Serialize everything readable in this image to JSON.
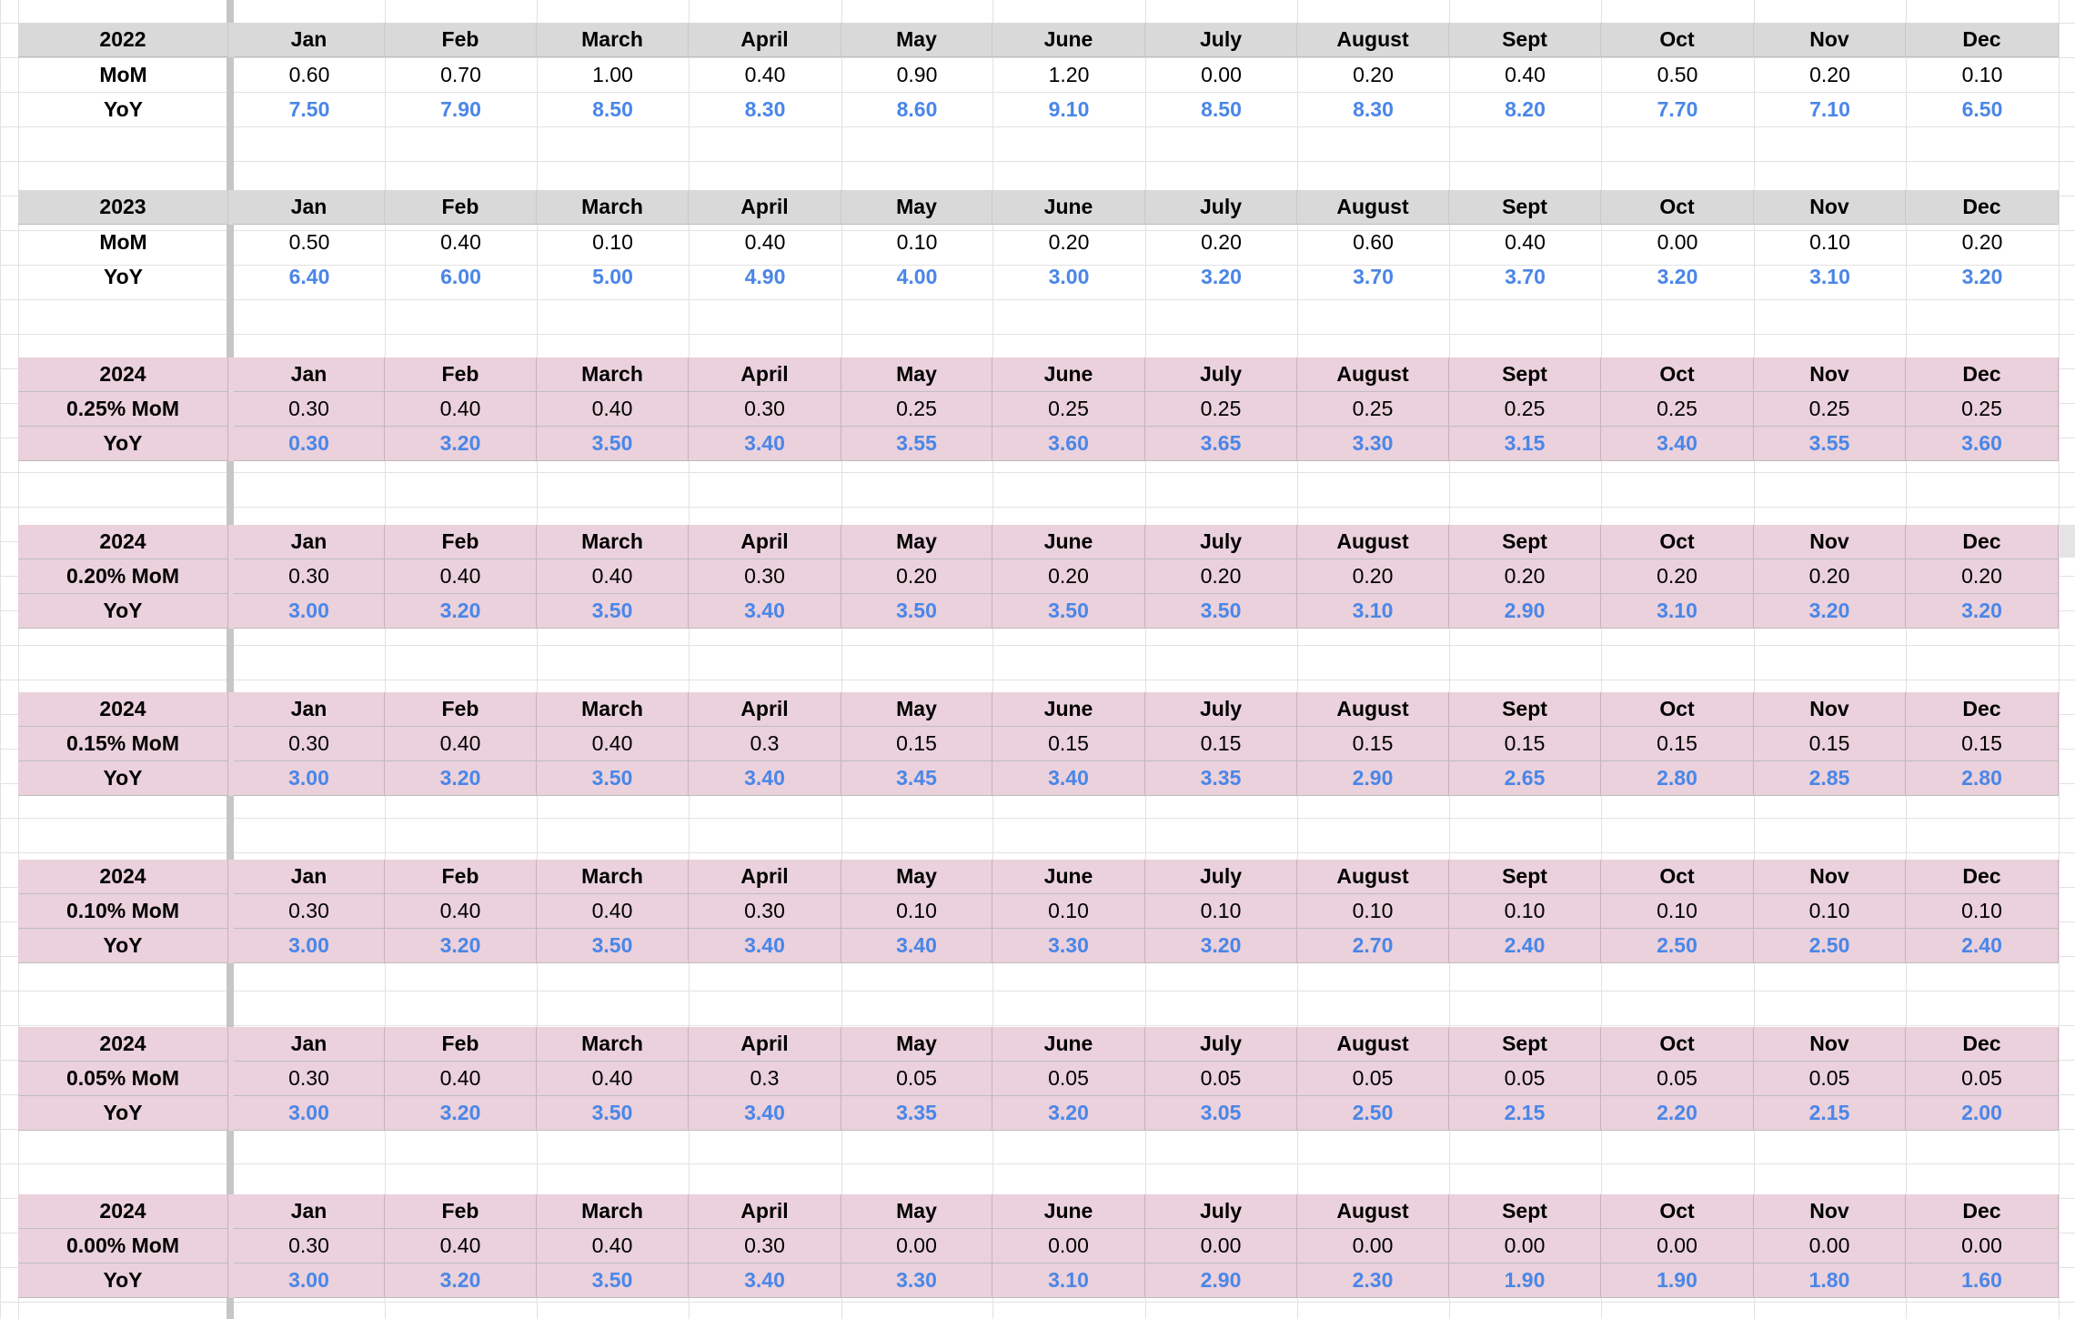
{
  "months": [
    "Jan",
    "Feb",
    "March",
    "April",
    "May",
    "June",
    "July",
    "August",
    "Sept",
    "Oct",
    "Nov",
    "Dec"
  ],
  "blocks": [
    {
      "style": "gray",
      "year": "2022",
      "mom_label": "MoM",
      "yoy_label": "YoY",
      "mom": [
        "0.60",
        "0.70",
        "1.00",
        "0.40",
        "0.90",
        "1.20",
        "0.00",
        "0.20",
        "0.40",
        "0.50",
        "0.20",
        "0.10"
      ],
      "yoy": [
        "7.50",
        "7.90",
        "8.50",
        "8.30",
        "8.60",
        "9.10",
        "8.50",
        "8.30",
        "8.20",
        "7.70",
        "7.10",
        "6.50"
      ]
    },
    {
      "style": "gray",
      "year": "2023",
      "mom_label": "MoM",
      "yoy_label": "YoY",
      "mom": [
        "0.50",
        "0.40",
        "0.10",
        "0.40",
        "0.10",
        "0.20",
        "0.20",
        "0.60",
        "0.40",
        "0.00",
        "0.10",
        "0.20"
      ],
      "yoy": [
        "6.40",
        "6.00",
        "5.00",
        "4.90",
        "4.00",
        "3.00",
        "3.20",
        "3.70",
        "3.70",
        "3.20",
        "3.10",
        "3.20"
      ]
    },
    {
      "style": "pink",
      "year": "2024",
      "mom_label": "0.25% MoM",
      "yoy_label": "YoY",
      "mom": [
        "0.30",
        "0.40",
        "0.40",
        "0.30",
        "0.25",
        "0.25",
        "0.25",
        "0.25",
        "0.25",
        "0.25",
        "0.25",
        "0.25"
      ],
      "yoy": [
        "0.30",
        "3.20",
        "3.50",
        "3.40",
        "3.55",
        "3.60",
        "3.65",
        "3.30",
        "3.15",
        "3.40",
        "3.55",
        "3.60"
      ]
    },
    {
      "style": "pink",
      "year": "2024",
      "mom_label": "0.20% MoM",
      "yoy_label": "YoY",
      "mom": [
        "0.30",
        "0.40",
        "0.40",
        "0.30",
        "0.20",
        "0.20",
        "0.20",
        "0.20",
        "0.20",
        "0.20",
        "0.20",
        "0.20"
      ],
      "yoy": [
        "3.00",
        "3.20",
        "3.50",
        "3.40",
        "3.50",
        "3.50",
        "3.50",
        "3.10",
        "2.90",
        "3.10",
        "3.20",
        "3.20"
      ]
    },
    {
      "style": "pink",
      "year": "2024",
      "mom_label": "0.15% MoM",
      "yoy_label": "YoY",
      "mom": [
        "0.30",
        "0.40",
        "0.40",
        "0.3",
        "0.15",
        "0.15",
        "0.15",
        "0.15",
        "0.15",
        "0.15",
        "0.15",
        "0.15"
      ],
      "yoy": [
        "3.00",
        "3.20",
        "3.50",
        "3.40",
        "3.45",
        "3.40",
        "3.35",
        "2.90",
        "2.65",
        "2.80",
        "2.85",
        "2.80"
      ]
    },
    {
      "style": "pink",
      "year": "2024",
      "mom_label": "0.10% MoM",
      "yoy_label": "YoY",
      "mom": [
        "0.30",
        "0.40",
        "0.40",
        "0.30",
        "0.10",
        "0.10",
        "0.10",
        "0.10",
        "0.10",
        "0.10",
        "0.10",
        "0.10"
      ],
      "yoy": [
        "3.00",
        "3.20",
        "3.50",
        "3.40",
        "3.40",
        "3.30",
        "3.20",
        "2.70",
        "2.40",
        "2.50",
        "2.50",
        "2.40"
      ]
    },
    {
      "style": "pink",
      "year": "2024",
      "mom_label": "0.05% MoM",
      "yoy_label": "YoY",
      "mom": [
        "0.30",
        "0.40",
        "0.40",
        "0.3",
        "0.05",
        "0.05",
        "0.05",
        "0.05",
        "0.05",
        "0.05",
        "0.05",
        "0.05"
      ],
      "yoy": [
        "3.00",
        "3.20",
        "3.50",
        "3.40",
        "3.35",
        "3.20",
        "3.05",
        "2.50",
        "2.15",
        "2.20",
        "2.15",
        "2.00"
      ]
    },
    {
      "style": "pink",
      "year": "2024",
      "mom_label": "0.00% MoM",
      "yoy_label": "YoY",
      "mom": [
        "0.30",
        "0.40",
        "0.40",
        "0.30",
        "0.00",
        "0.00",
        "0.00",
        "0.00",
        "0.00",
        "0.00",
        "0.00",
        "0.00"
      ],
      "yoy": [
        "3.00",
        "3.20",
        "3.50",
        "3.40",
        "3.30",
        "3.10",
        "2.90",
        "2.30",
        "1.90",
        "1.90",
        "1.80",
        "1.60"
      ]
    }
  ],
  "colors": {
    "gray_header": "#d9d9d9",
    "pink_band": "#ead1dc",
    "yoy_text": "#4a86e8",
    "gridline": "#e2e2e2"
  }
}
